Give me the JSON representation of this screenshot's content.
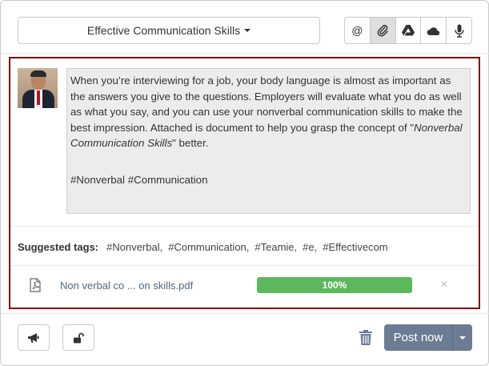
{
  "header": {
    "topic_label": "Effective Communication Skills",
    "attach_buttons": [
      {
        "name": "mention",
        "icon": "at-icon",
        "glyph": "@"
      },
      {
        "name": "attach-file",
        "icon": "paperclip-icon",
        "active": true
      },
      {
        "name": "google-drive",
        "icon": "google-drive-icon"
      },
      {
        "name": "onedrive",
        "icon": "cloud-icon"
      },
      {
        "name": "audio",
        "icon": "microphone-icon"
      }
    ]
  },
  "post": {
    "body_line1": "When you’re interviewing for a job, your body language is almost as important as the answers you give to the questions. Employers will evaluate what you do as well as what you say, and you can use your nonverbal communication skills to make the best impression. Attached is document to help you grasp the concept of \"",
    "body_emph": "Nonverbal Communication Skills",
    "body_line2": "\" better.",
    "hashtags": "#Nonverbal #Communication"
  },
  "suggested_tags": {
    "label": "Suggested tags:",
    "tags": [
      "#Nonverbal,",
      "#Communication,",
      "#Teamie,",
      "#e,",
      "#Effectivecom"
    ]
  },
  "attachment": {
    "file_name": "Non verbal co ... on skills.pdf",
    "progress_text": "100%",
    "progress_value": 100,
    "remove_glyph": "×"
  },
  "footer": {
    "post_label": "Post now"
  },
  "colors": {
    "composer_border": "#7d0b0b",
    "progress_fill": "#5cb85c",
    "post_button": "#6d7c95"
  }
}
